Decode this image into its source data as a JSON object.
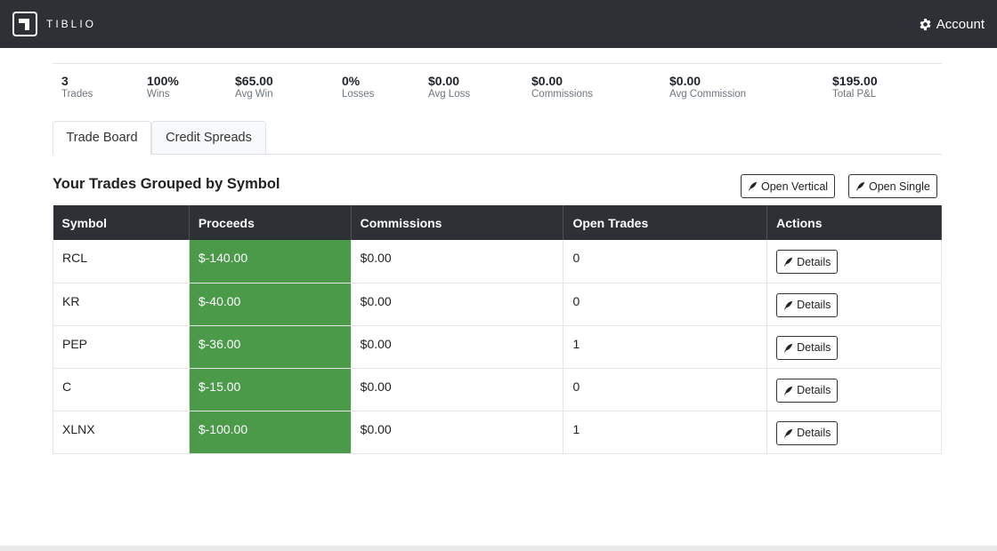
{
  "navbar": {
    "brand": "TIBLIO",
    "account_label": "Account"
  },
  "stats": [
    {
      "value": "3",
      "label": "Trades"
    },
    {
      "value": "100%",
      "label": "Wins"
    },
    {
      "value": "$65.00",
      "label": "Avg Win"
    },
    {
      "value": "0%",
      "label": "Losses"
    },
    {
      "value": "$0.00",
      "label": "Avg Loss"
    },
    {
      "value": "$0.00",
      "label": "Commissions"
    },
    {
      "value": "$0.00",
      "label": "Avg Commission"
    },
    {
      "value": "$195.00",
      "label": "Total P&L"
    }
  ],
  "tabs": [
    {
      "label": "Trade Board",
      "active": true
    },
    {
      "label": "Credit Spreads",
      "active": false
    }
  ],
  "section": {
    "title": "Your Trades Grouped by Symbol",
    "open_vertical_label": "Open Vertical",
    "open_single_label": "Open Single"
  },
  "table": {
    "headers": [
      "Symbol",
      "Proceeds",
      "Commissions",
      "Open Trades",
      "Actions"
    ],
    "rows": [
      {
        "symbol": "RCL",
        "proceeds": "$-140.00",
        "commissions": "$0.00",
        "open_trades": "0",
        "action": "Details"
      },
      {
        "symbol": "KR",
        "proceeds": "$-40.00",
        "commissions": "$0.00",
        "open_trades": "0",
        "action": "Details"
      },
      {
        "symbol": "PEP",
        "proceeds": "$-36.00",
        "commissions": "$0.00",
        "open_trades": "1",
        "action": "Details"
      },
      {
        "symbol": "C",
        "proceeds": "$-15.00",
        "commissions": "$0.00",
        "open_trades": "0",
        "action": "Details"
      },
      {
        "symbol": "XLNX",
        "proceeds": "$-100.00",
        "commissions": "$0.00",
        "open_trades": "1",
        "action": "Details"
      }
    ]
  },
  "colors": {
    "navbar_bg": "#2d3136",
    "proceeds_bg": "#4b9a4a"
  },
  "icons": {
    "logo": "tiblio-logo-icon",
    "account": "gear-icon",
    "button": "feather-icon"
  }
}
